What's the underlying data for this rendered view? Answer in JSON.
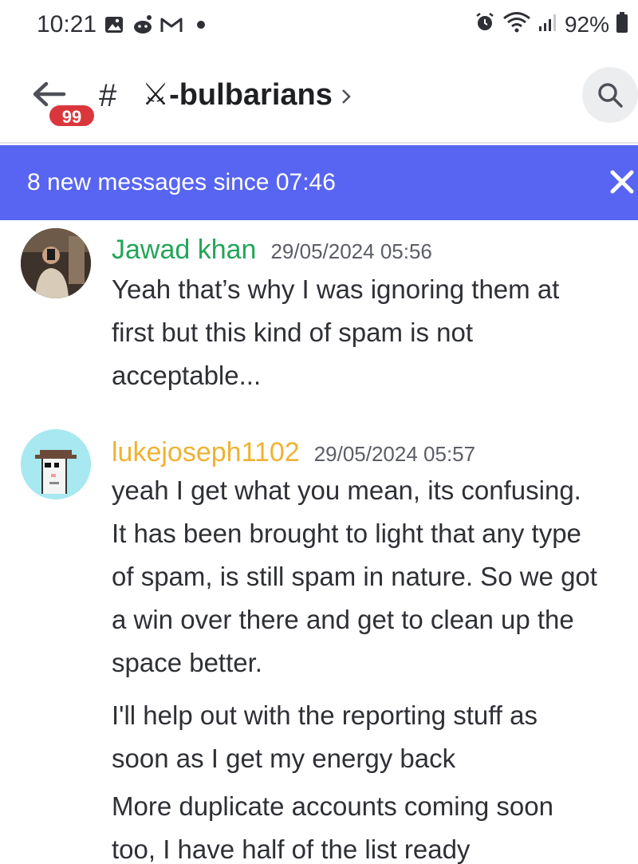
{
  "status_bar": {
    "time": "10:21",
    "battery": "92%",
    "icons": [
      "gallery-icon",
      "reddit-icon",
      "gmail-icon",
      "dot-icon",
      "alarm-icon",
      "wifi-icon",
      "signal-icon",
      "battery-icon"
    ]
  },
  "header": {
    "badge_count": "99",
    "hash": "#",
    "channel_name": "⚔-bulbarians",
    "chevron": "›"
  },
  "banner": {
    "text": "8 new messages since 07:46",
    "close": "×",
    "color": "#5865f2"
  },
  "messages": [
    {
      "username": "Jawad khan",
      "username_color": "#23a55a",
      "timestamp": "29/05/2024 05:56",
      "lines": [
        "Yeah that’s why I was ignoring them at",
        "first but this kind of spam is not",
        "acceptable..."
      ]
    },
    {
      "username": "lukejoseph1102",
      "username_color": "#f0b232",
      "timestamp": "29/05/2024 05:57",
      "lines": [
        "yeah I get what you mean, its confusing.",
        "It has been brought to light that any type",
        "of spam, is still spam in nature. So we got",
        "a win over there and get to clean up the",
        "space better."
      ],
      "followups": [
        [
          "I'll help out with the reporting stuff as",
          "soon as I get my energy back"
        ],
        [
          "More duplicate accounts coming soon",
          "too, I have half of the list ready"
        ]
      ]
    }
  ]
}
